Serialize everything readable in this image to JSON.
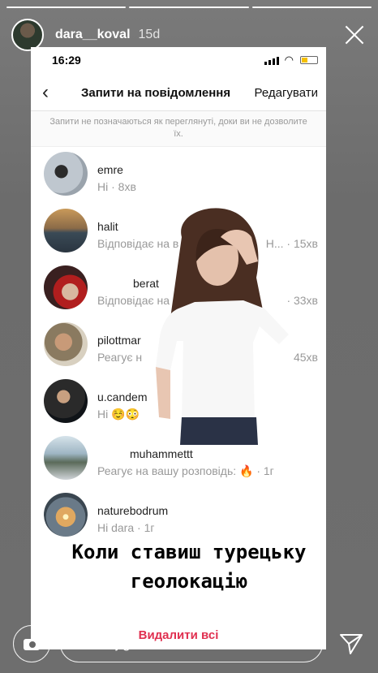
{
  "story": {
    "username": "dara__koval",
    "age": "15d",
    "caption_line1": "Коли ставиш турецьку",
    "caption_line2": "геолокацію"
  },
  "phone": {
    "time": "16:29",
    "title": "Запити на повідомлення",
    "edit": "Редагувати",
    "notice": "Запити не позначаються як переглянуті, доки ви не дозволите їх.",
    "delete_all": "Видалити всі"
  },
  "requests": [
    {
      "name": "emre",
      "message": "Hi · 8хв",
      "meta": ""
    },
    {
      "name": "halit",
      "message": "Відповідає на в",
      "meta": "Н... · 15хв"
    },
    {
      "name": "berat",
      "message": "Відповідає на в",
      "meta": "· 33хв"
    },
    {
      "name": "pilottmar",
      "message": "Реагує н",
      "meta": "45хв"
    },
    {
      "name": "u.candem",
      "message": "Hi ☺️😳",
      "meta": ""
    },
    {
      "name": "muhammettt",
      "message": "Реагує на вашу розповідь: 🔥 · 1г",
      "meta": ""
    },
    {
      "name": "naturebodrum",
      "message": "Hi dara · 1г",
      "meta": ""
    }
  ],
  "reply": {
    "placeholder": "Mesaj gönder",
    "more": "•••"
  },
  "colors": {
    "accent": "#e03050",
    "overlay_bg": "#6e6e6e"
  },
  "icons": [
    "close-icon",
    "back-chevron-icon",
    "camera-icon",
    "send-icon"
  ]
}
